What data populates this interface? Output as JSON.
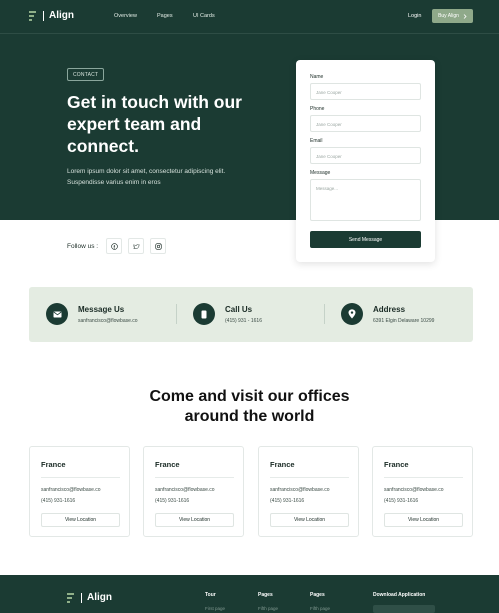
{
  "header": {
    "logo": "Align",
    "nav": [
      "Overview",
      "Pages",
      "UI Cards"
    ],
    "login": "Login",
    "buy": "Buy Align",
    "buy_icon": "chevron-right-icon"
  },
  "hero": {
    "badge": "CONTACT",
    "title": "Get in touch with our expert team and connect.",
    "text": "Lorem ipsum dolor sit amet, consectetur adipiscing elit. Suspendisse varius enim in eros"
  },
  "form": {
    "name_label": "Name",
    "name_placeholder": "Jane Cooper",
    "phone_label": "Phone",
    "phone_placeholder": "Jane Cooper",
    "email_label": "Email",
    "email_placeholder": "Jane Cooper",
    "message_label": "Message",
    "message_placeholder": "Message...",
    "submit": "Send Message"
  },
  "follow": {
    "label": "Follow us :",
    "icons": [
      "facebook-icon",
      "twitter-icon",
      "instagram-icon"
    ]
  },
  "contact": [
    {
      "title": "Message Us",
      "sub": "sanfrancisco@flowbase.co",
      "icon": "mail-icon"
    },
    {
      "title": "Call Us",
      "sub": "(415) 931 - 1616",
      "icon": "phone-icon"
    },
    {
      "title": "Address",
      "sub": "6391 Elgin Delaware 10299",
      "icon": "location-pin-icon"
    }
  ],
  "offices": {
    "title_line1": "Come and visit our offices",
    "title_line2": "around the world",
    "cards": [
      {
        "country": "France",
        "email": "sanfrancisco@flowbase.co",
        "phone": "(415) 931-1616",
        "button": "View Location"
      },
      {
        "country": "France",
        "email": "sanfrancisco@flowbase.co",
        "phone": "(415) 931-1616",
        "button": "View Location"
      },
      {
        "country": "France",
        "email": "sanfrancisco@flowbase.co",
        "phone": "(415) 931-1616",
        "button": "View Location"
      },
      {
        "country": "France",
        "email": "sanfrancisco@flowbase.co",
        "phone": "(415) 931-1616",
        "button": "View Location"
      }
    ]
  },
  "footer": {
    "logo": "Align",
    "cols": [
      "Tour",
      "Pages",
      "Pages",
      "Download Application"
    ],
    "subs": [
      "First page",
      "Fifth page",
      "Fifth page"
    ]
  },
  "colors": {
    "primary": "#1b3b33",
    "accent": "#8fa98a",
    "strip_bg": "#e4ece2"
  }
}
